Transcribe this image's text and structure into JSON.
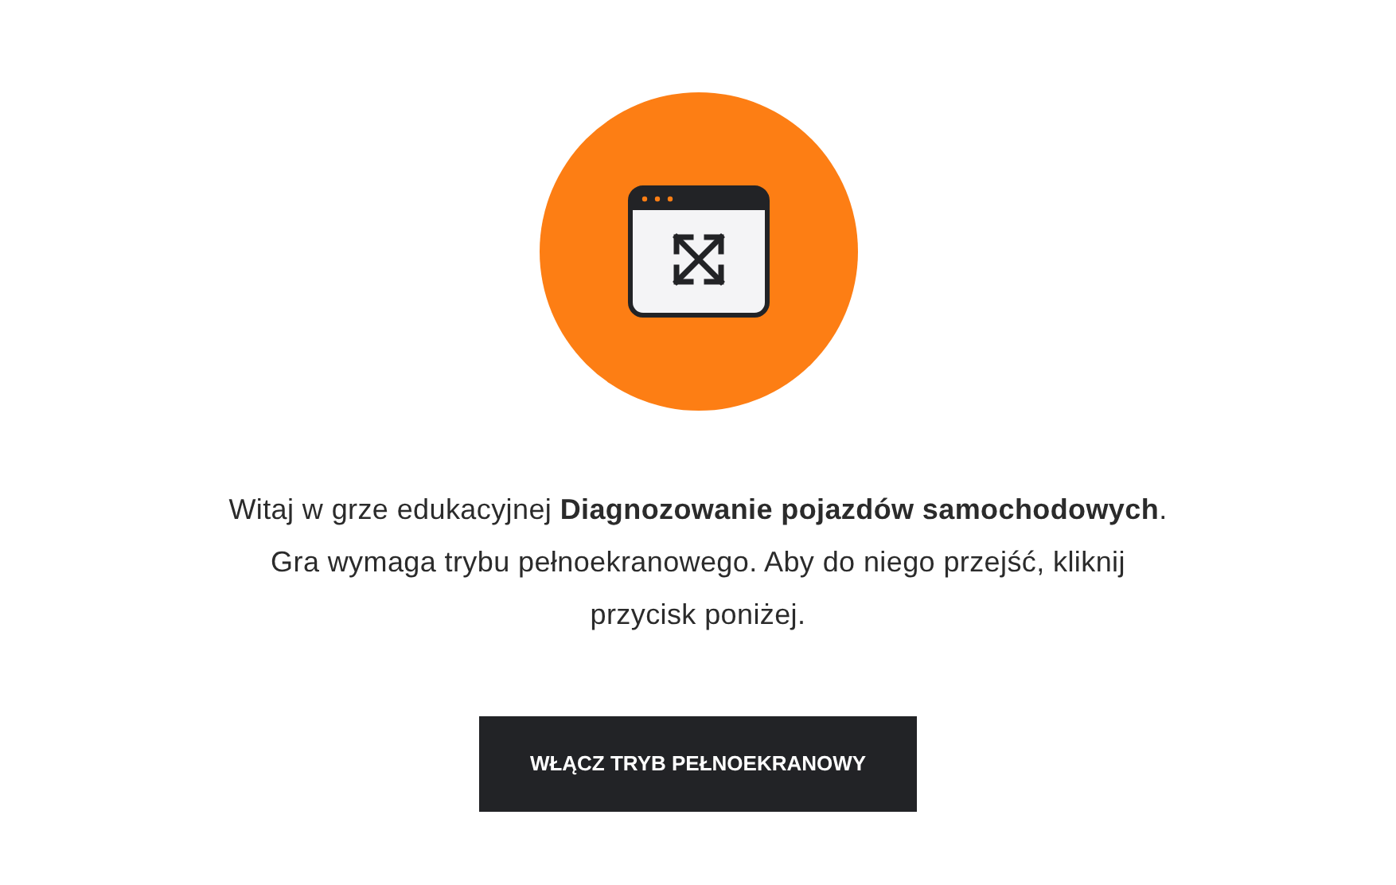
{
  "intro": "Witaj w grze edukacyjnej **Diagnozowanie pojazdów samochodowych**. Gra wymaga trybu pełnoekranowego. Aby do niego przejść, kliknij przycisk poniżej.",
  "button": "WŁĄCZ TRYB PEŁNOEKRANOWY"
}
